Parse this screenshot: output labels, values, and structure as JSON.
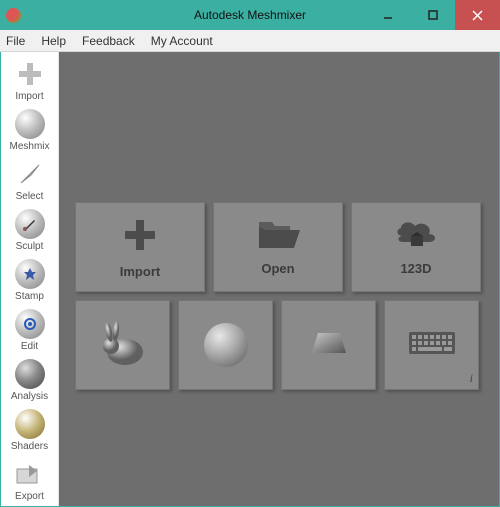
{
  "window": {
    "title": "Autodesk Meshmixer"
  },
  "menu": {
    "file": "File",
    "help": "Help",
    "feedback": "Feedback",
    "account": "My Account"
  },
  "sidebar": {
    "import": "Import",
    "meshmix": "Meshmix",
    "select": "Select",
    "sculpt": "Sculpt",
    "stamp": "Stamp",
    "edit": "Edit",
    "analysis": "Analysis",
    "shaders": "Shaders",
    "export": "Export"
  },
  "tiles": {
    "import": "Import",
    "open": "Open",
    "onetwothree": "123D"
  }
}
